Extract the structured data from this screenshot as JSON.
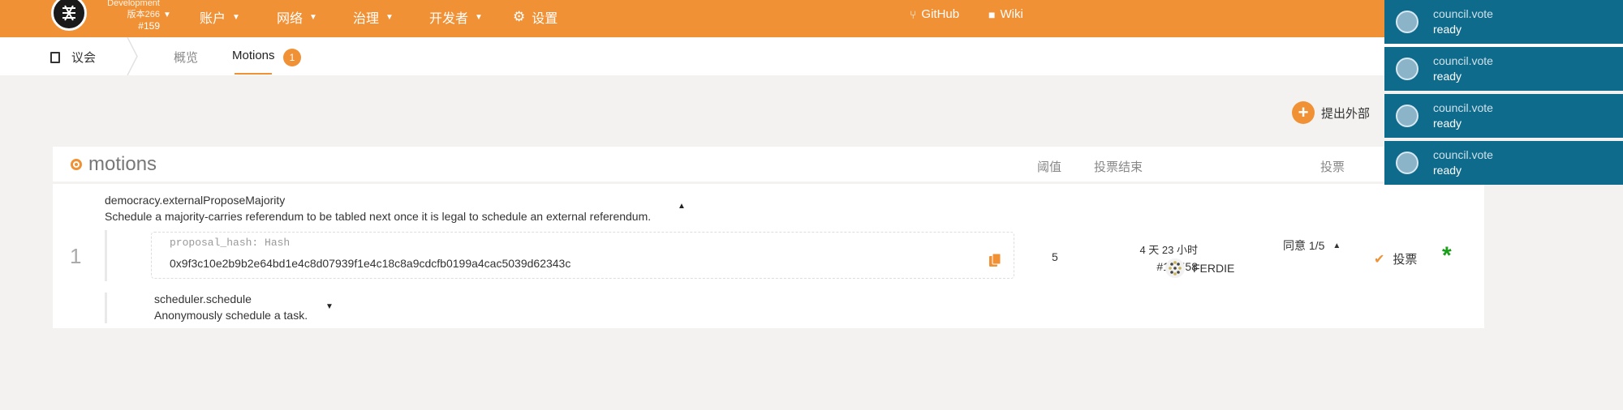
{
  "topbar": {
    "chain": {
      "name": "Development",
      "version": "版本266",
      "block": "#159"
    },
    "menu": {
      "accounts": "账户",
      "network": "网络",
      "governance": "治理",
      "developer": "开发者",
      "settings": "设置",
      "github": "GitHub",
      "wiki": "Wiki"
    }
  },
  "subbar": {
    "section": "议会",
    "tabs": {
      "overview": "概览",
      "motions": "Motions",
      "motions_count": "1"
    }
  },
  "actions": {
    "propose_external": "提出外部"
  },
  "table": {
    "title": "motions",
    "headers": {
      "threshold": "阈值",
      "voting_end": "投票结束",
      "votes": "投票"
    },
    "rows": [
      {
        "index": "1",
        "proposal_call": "democracy.externalProposeMajority",
        "proposal_desc": "Schedule a majority-carries referendum to be tabled next once it is legal to schedule an external referendum.",
        "param_label": "proposal_hash: Hash",
        "param_value": "0x9f3c10e2b9b2e64bd1e4c8d07939f1e4c18c8a9cdcfb0199a4cac5039d62343c",
        "inner_call": "scheduler.schedule",
        "inner_desc": "Anonymously schedule a task.",
        "threshold": "5",
        "end_time": "4 天 23 小时",
        "end_block": "#14,558",
        "voter": "FERDIE",
        "agree": "同意 1/5",
        "vote_button": "投票"
      }
    ]
  },
  "toasts": [
    {
      "method": "council.vote",
      "status": "ready"
    },
    {
      "method": "council.vote",
      "status": "ready"
    },
    {
      "method": "council.vote",
      "status": "ready"
    },
    {
      "method": "council.vote",
      "status": "ready"
    }
  ],
  "colors": {
    "accent": "#f19135",
    "toast": "#0f6b8c",
    "success": "#1a9e1a"
  }
}
